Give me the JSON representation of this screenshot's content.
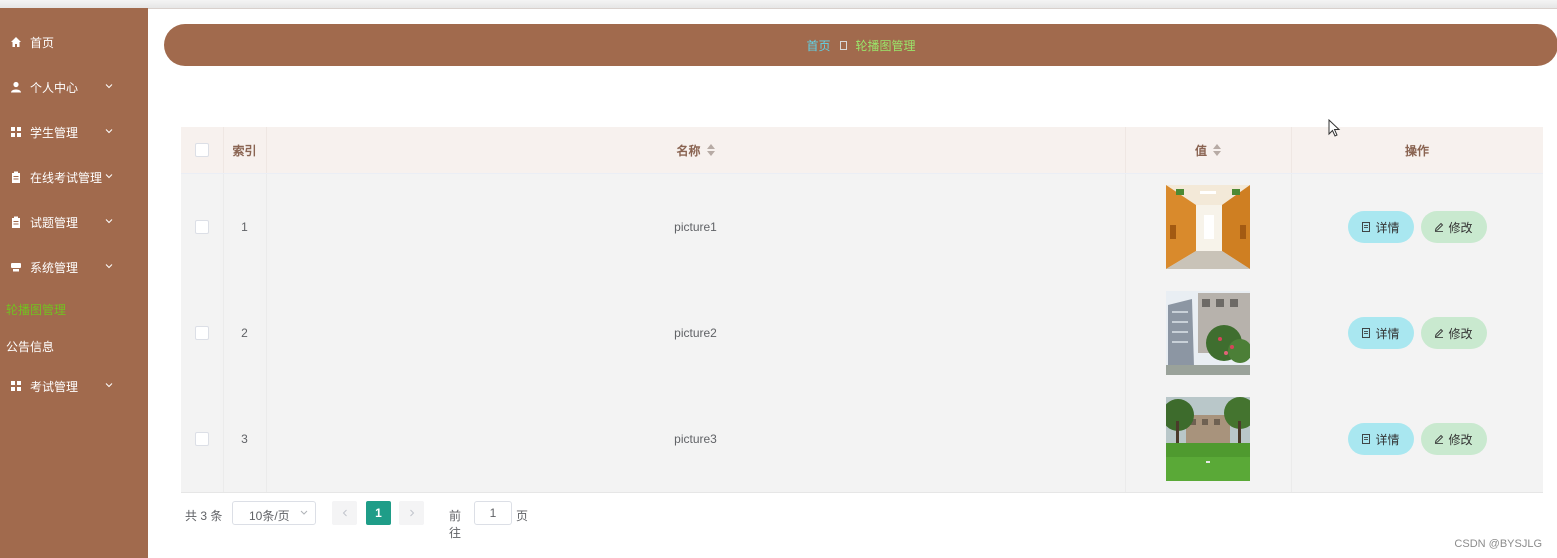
{
  "sidebar": {
    "items": [
      {
        "label": "首页",
        "icon": "home-icon"
      },
      {
        "label": "个人中心",
        "icon": "user-icon"
      },
      {
        "label": "学生管理",
        "icon": "grid-icon"
      },
      {
        "label": "在线考试管理",
        "icon": "clipboard-icon"
      },
      {
        "label": "试题管理",
        "icon": "clipboard-icon"
      },
      {
        "label": "系统管理",
        "icon": "stack-icon"
      },
      {
        "label": "轮播图管理",
        "active": true
      },
      {
        "label": "公告信息"
      },
      {
        "label": "考试管理",
        "icon": "grid-icon"
      }
    ]
  },
  "breadcrumb": {
    "home": "首页",
    "current": "轮播图管理"
  },
  "table": {
    "headers": {
      "index": "索引",
      "name": "名称",
      "value": "值",
      "actions": "操作"
    },
    "rows": [
      {
        "index": "1",
        "name": "picture1",
        "image": "library-hall-photo"
      },
      {
        "index": "2",
        "name": "picture2",
        "image": "campus-building-photo"
      },
      {
        "index": "3",
        "name": "picture3",
        "image": "campus-lawn-photo"
      }
    ],
    "detail_label": "详情",
    "edit_label": "修改"
  },
  "pagination": {
    "total": "共 3 条",
    "page_size": "10条/页",
    "current_page": "1",
    "goto_label": "前往",
    "goto_value": "1",
    "page_suffix": "页"
  },
  "watermark": "CSDN @BYSJLG",
  "colors": {
    "sidebar_bg": "#a16a4d",
    "active_menu": "#73c021",
    "crumb_home": "#5fd3e8",
    "crumb_current": "#9ae66a",
    "detail_button": "#a9e7f0",
    "edit_button": "#c9e9cf",
    "pager_active": "#1f9d88"
  }
}
